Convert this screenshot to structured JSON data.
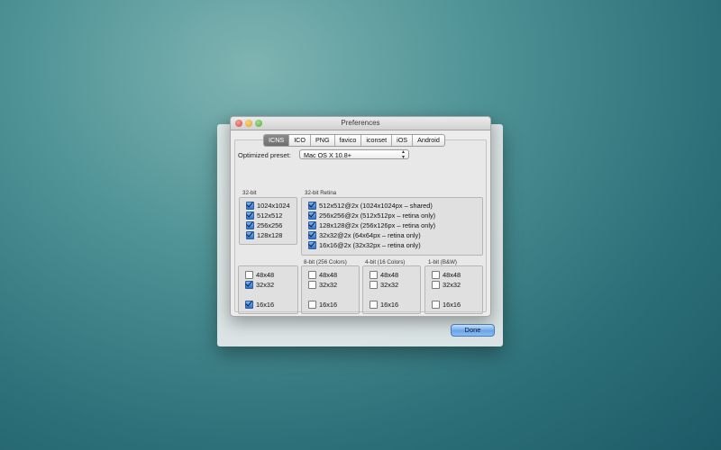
{
  "window": {
    "title": "Preferences"
  },
  "tabs": [
    {
      "label": "ICNS",
      "active": true
    },
    {
      "label": "ICO",
      "active": false
    },
    {
      "label": "PNG",
      "active": false
    },
    {
      "label": "favico",
      "active": false
    },
    {
      "label": "iconset",
      "active": false
    },
    {
      "label": "iOS",
      "active": false
    },
    {
      "label": "Android",
      "active": false
    }
  ],
  "preset": {
    "label": "Optimized preset:",
    "value": "Mac OS X 10.8+"
  },
  "groups": {
    "bit32": {
      "label": "32-bit",
      "items": [
        {
          "label": "1024x1024",
          "checked": true
        },
        {
          "label": "512x512",
          "checked": true
        },
        {
          "label": "256x256",
          "checked": true
        },
        {
          "label": "128x128",
          "checked": true
        }
      ]
    },
    "retina": {
      "label": "32-bit Retina",
      "items": [
        {
          "label": "512x512@2x (1024x1024px – shared)",
          "checked": true
        },
        {
          "label": "256x256@2x (512x512px – retina only)",
          "checked": true
        },
        {
          "label": "128x128@2x (256x126px – retina only)",
          "checked": true
        },
        {
          "label": "32x32@2x (64x64px – retina only)",
          "checked": true
        },
        {
          "label": "16x16@2x (32x32px – retina only)",
          "checked": true
        }
      ]
    },
    "bit32_lower": {
      "items": [
        {
          "label": "48x48",
          "checked": false
        },
        {
          "label": "32x32",
          "checked": true
        },
        {
          "label": "16x16",
          "checked": true
        }
      ]
    },
    "bit8": {
      "label": "8-bit (256 Colors)",
      "items": [
        {
          "label": "48x48",
          "checked": false
        },
        {
          "label": "32x32",
          "checked": false
        },
        {
          "label": "16x16",
          "checked": false
        }
      ]
    },
    "bit4": {
      "label": "4-bit (16 Colors)",
      "items": [
        {
          "label": "48x48",
          "checked": false
        },
        {
          "label": "32x32",
          "checked": false
        },
        {
          "label": "16x16",
          "checked": false
        }
      ]
    },
    "bit1": {
      "label": "1-bit (B&W)",
      "items": [
        {
          "label": "48x48",
          "checked": false
        },
        {
          "label": "32x32",
          "checked": false
        },
        {
          "label": "16x16",
          "checked": false
        }
      ]
    }
  },
  "done_label": "Done",
  "colors": {
    "accent": "#2f74d0",
    "desktop": "#2d7079"
  }
}
